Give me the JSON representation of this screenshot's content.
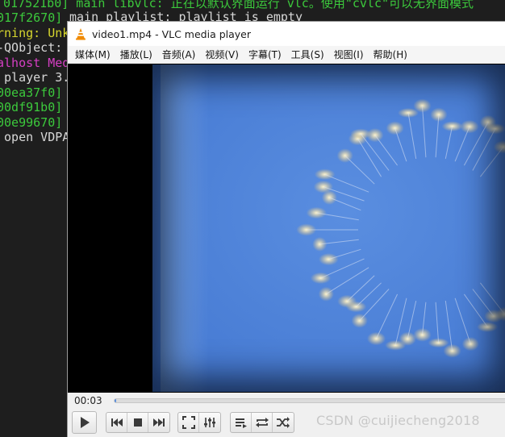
{
  "terminal": {
    "top_line_1": "017521b0] main libvlc: 正在以默认界面运行 vlc。使用\"cvlc\"可以无界面模式",
    "top_line_2": "main playlist: playlist is empty",
    "lines": [
      {
        "text": "017f2670]",
        "color": "green"
      },
      {
        "text": "rning: Unk",
        "color": "yellow"
      },
      {
        "text": "-QObject:",
        "color": "white"
      },
      {
        "text": "alhost Med",
        "color": "magenta"
      },
      {
        "text": " player 3.",
        "color": "white"
      },
      {
        "text": "00ea37f0]",
        "color": "green"
      },
      {
        "text": "00df91b0]",
        "color": "green"
      },
      {
        "text": "00e99670]",
        "color": "green"
      },
      {
        "text": " open VDPA",
        "color": "white"
      }
    ]
  },
  "window": {
    "title": "video1.mp4 - VLC media player",
    "icon": "vlc-cone-icon"
  },
  "menu": [
    "媒体(M)",
    "播放(L)",
    "音频(A)",
    "视频(V)",
    "字幕(T)",
    "工具(S)",
    "视图(I)",
    "帮助(H)"
  ],
  "player": {
    "current_time": "00:03",
    "progress_fraction": 0.005,
    "accent_color": "#5a8fdc"
  },
  "controls": {
    "play": "play-icon",
    "nav": [
      "previous-icon",
      "stop-icon",
      "next-icon"
    ],
    "view": [
      "fullscreen-icon",
      "extended-settings-icon"
    ],
    "list": [
      "playlist-icon",
      "loop-icon",
      "shuffle-icon"
    ]
  },
  "watermark": "CSDN @cuijiecheng2018"
}
